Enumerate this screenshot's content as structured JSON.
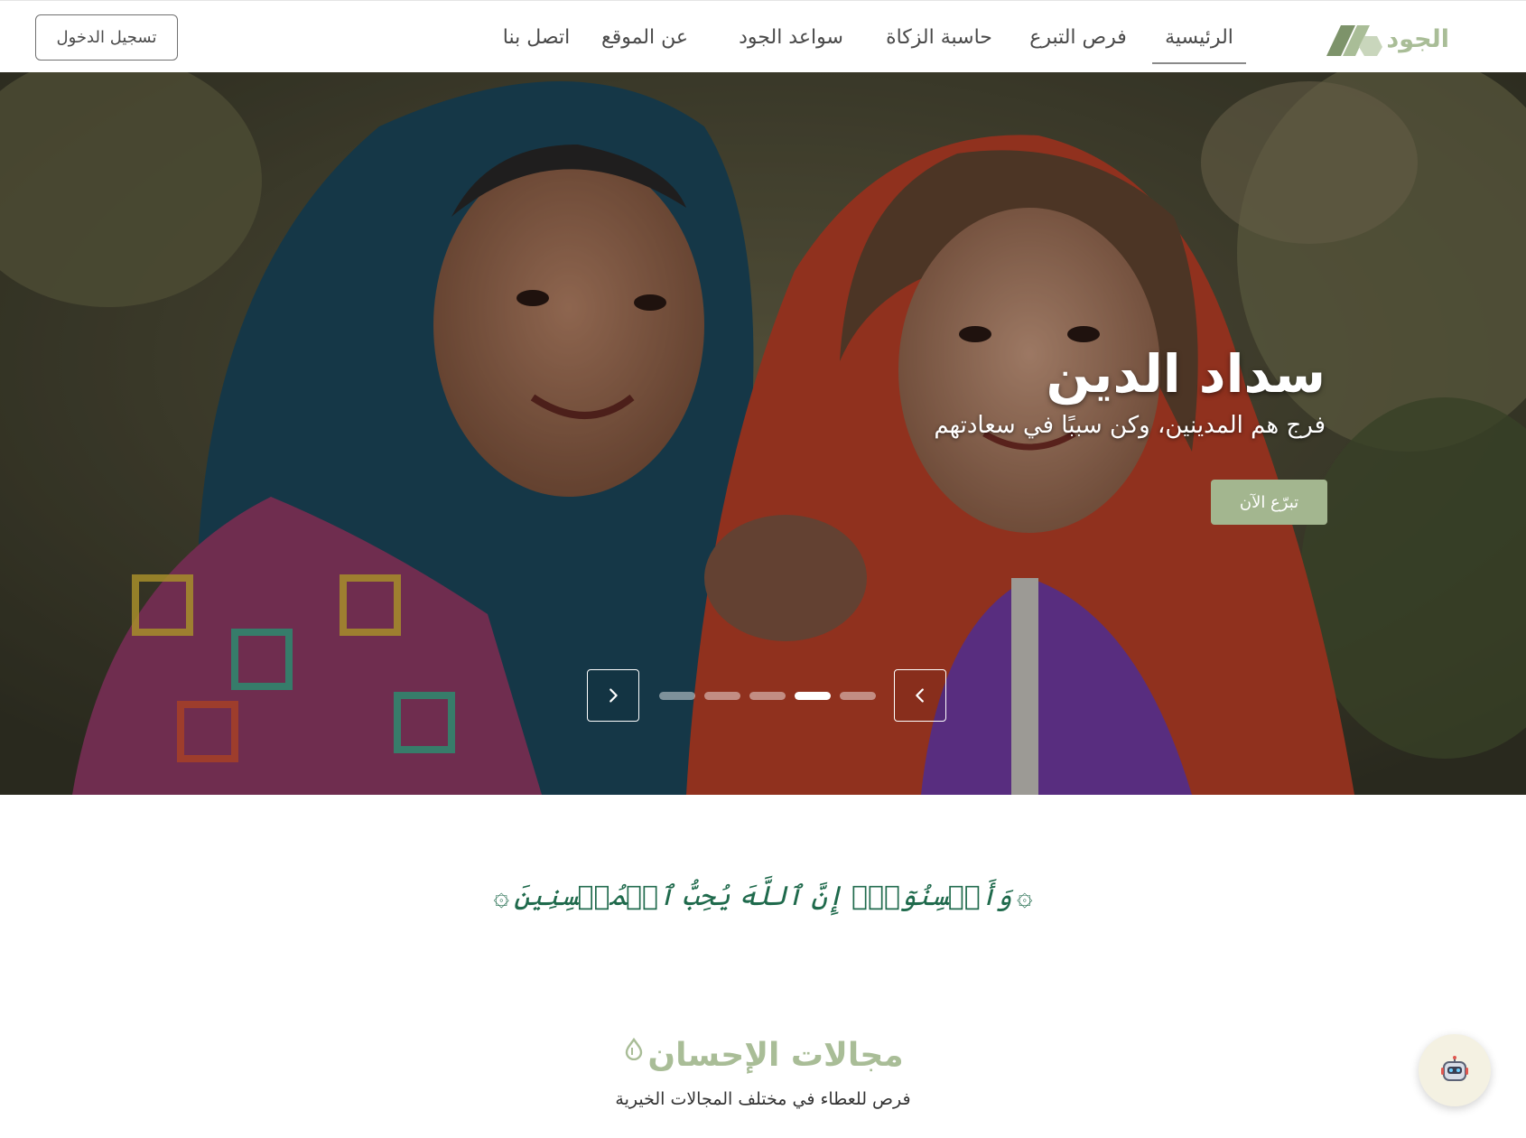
{
  "brand": {
    "name": "الجود",
    "color": "#a9bd97",
    "dark_color": "#7d936a"
  },
  "nav": {
    "items": [
      {
        "label": "الرئيسية",
        "active": true
      },
      {
        "label": "فرص التبرع",
        "active": false
      },
      {
        "label": "حاسبة الزكاة",
        "active": false
      },
      {
        "label": "سواعد الجود",
        "active": false
      },
      {
        "label": "عن الموقع",
        "active": false
      },
      {
        "label": "اتصل بنا",
        "active": false
      }
    ],
    "login_label": "تسجيل الدخول"
  },
  "hero": {
    "title": "سداد الدين",
    "subtitle": "فرج هم المدينين، وكن سببًا في سعادتهم",
    "cta_label": "تبرّع الآن",
    "cta_color": "#a3b68f",
    "slide_count": 5,
    "active_slide": 4
  },
  "verse": {
    "text": "وَأَحۡسِنُوٓاْۚ إِنَّ ٱللَّهَ يُحِبُّ ٱلۡمُحۡسِنِينَ",
    "color": "#1f6a4c"
  },
  "section": {
    "title": "مجالات الإحسان",
    "subtitle": "فرص للعطاء في مختلف المجالات الخيرية"
  },
  "icons": {
    "logo": "leaf-logo-icon",
    "prev": "chevron-left-icon",
    "next": "chevron-right-icon",
    "chatbot": "robot-icon",
    "title_ornament": "drop-icon"
  }
}
